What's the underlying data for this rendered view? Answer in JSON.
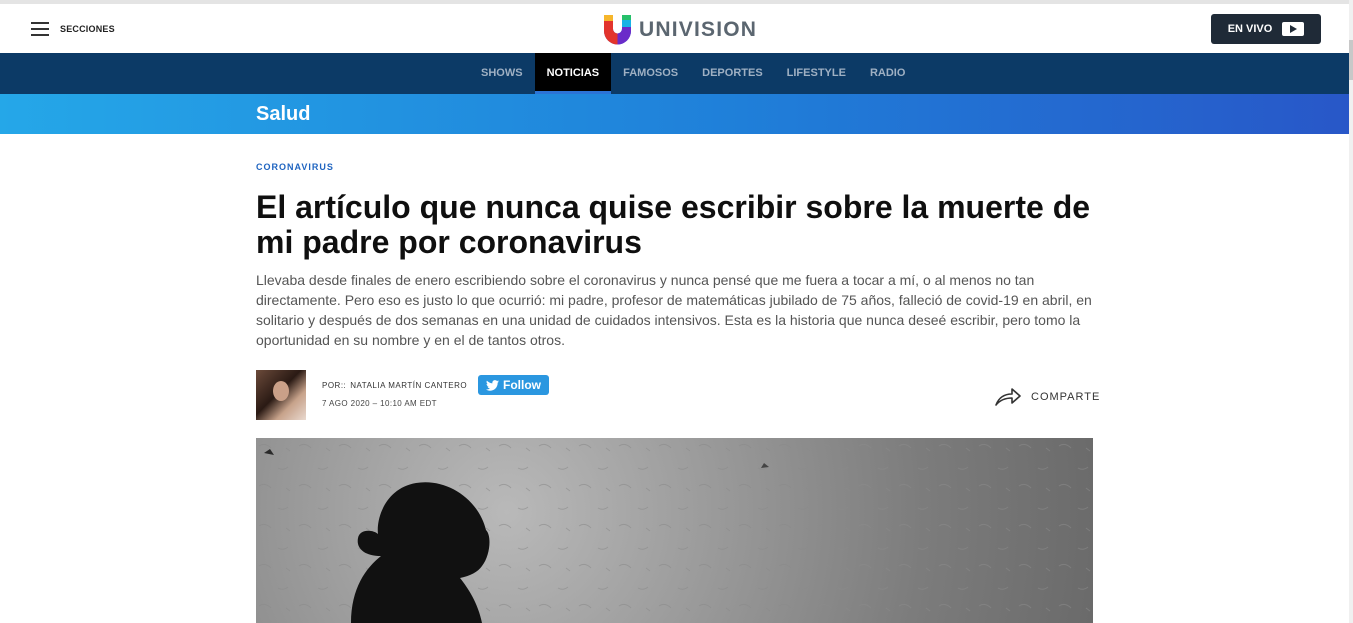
{
  "header": {
    "menu_label": "SECCIONES",
    "logo_text": "UNIVISION",
    "live_label": "EN VIVO"
  },
  "nav": {
    "items": [
      {
        "label": "SHOWS",
        "active": false
      },
      {
        "label": "NOTICIAS",
        "active": true
      },
      {
        "label": "FAMOSOS",
        "active": false
      },
      {
        "label": "DEPORTES",
        "active": false
      },
      {
        "label": "LIFESTYLE",
        "active": false
      },
      {
        "label": "RADIO",
        "active": false
      }
    ]
  },
  "section": {
    "title": "Salud"
  },
  "article": {
    "kicker": "CORONAVIRUS",
    "headline": "El artículo que nunca quise escribir sobre la muerte de mi padre por coronavirus",
    "dek": "Llevaba desde finales de enero escribiendo sobre el coronavirus y nunca pensé que me fuera a tocar a mí, o al menos no tan directamente. Pero eso es justo lo que ocurrió: mi padre, profesor de matemáticas jubilado de 75 años, falleció de covid-19 en abril, en solitario y después de dos semanas en una unidad de cuidados intensivos. Esta es la historia que nunca deseé escribir, pero tomo la oportunidad en su nombre y en el de tantos otros.",
    "byline_prefix": "POR::",
    "author": "NATALIA MARTÍN CANTERO",
    "date": "7 AGO 2020 – 10:10 AM EDT",
    "follow_label": "Follow",
    "share_label": "COMPARTE"
  },
  "colors": {
    "nav_bg": "#0c3a66",
    "accent_blue": "#1f64c0",
    "live_bg": "#1f2a37",
    "twitter": "#2b97e0"
  },
  "icons": [
    "hamburger-icon",
    "univision-logo-icon",
    "play-icon",
    "twitter-bird-icon",
    "share-arrow-icon"
  ]
}
